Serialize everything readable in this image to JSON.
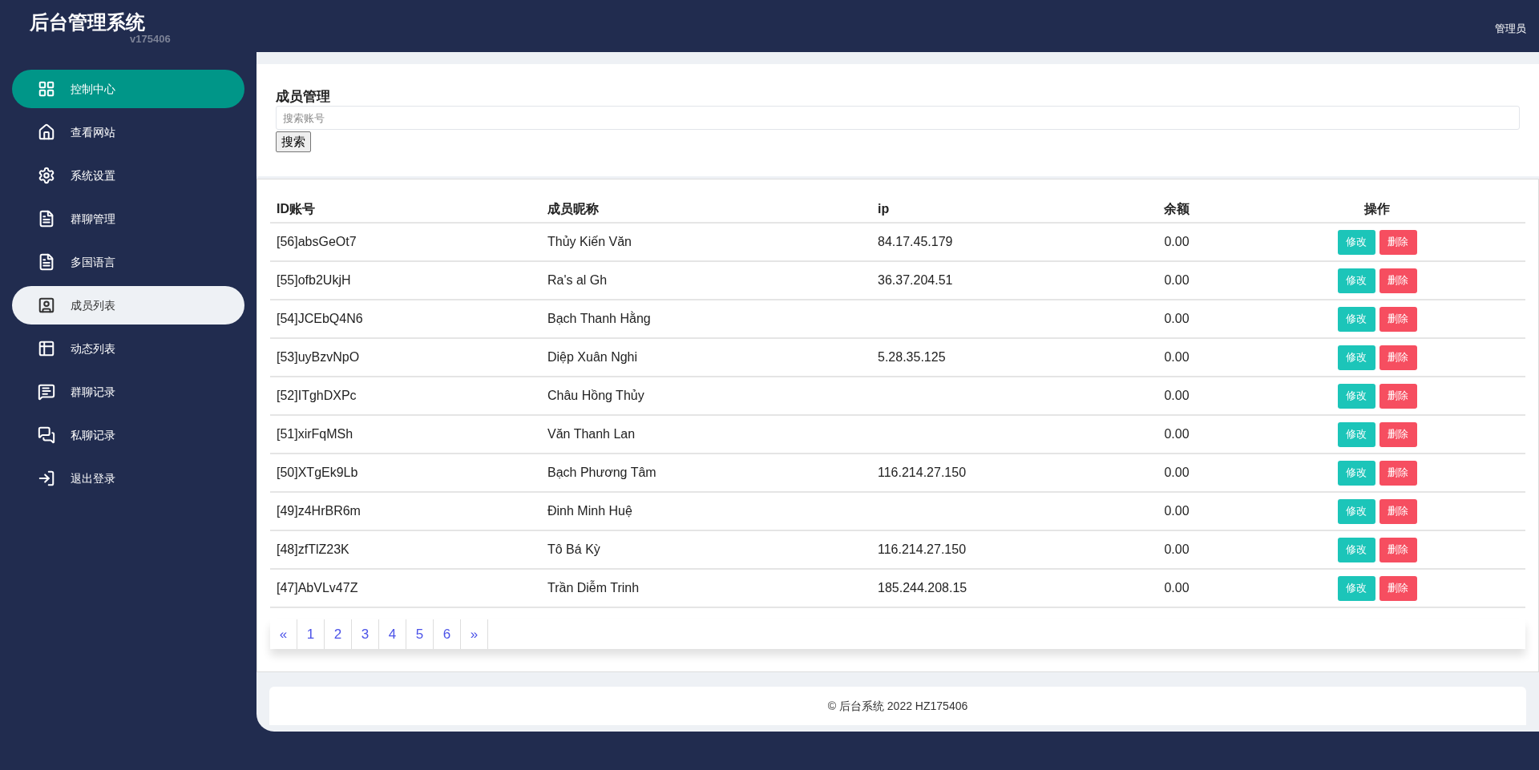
{
  "header": {
    "title": "后台管理系统",
    "version": "v175406",
    "user": "管理员"
  },
  "sidebar": {
    "items": [
      {
        "label": "控制中心",
        "highlighted": true,
        "selected": false
      },
      {
        "label": "查看网站",
        "highlighted": false,
        "selected": false
      },
      {
        "label": "系统设置",
        "highlighted": false,
        "selected": false
      },
      {
        "label": "群聊管理",
        "highlighted": false,
        "selected": false
      },
      {
        "label": "多国语言",
        "highlighted": false,
        "selected": false
      },
      {
        "label": "成员列表",
        "highlighted": false,
        "selected": true
      },
      {
        "label": "动态列表",
        "highlighted": false,
        "selected": false
      },
      {
        "label": "群聊记录",
        "highlighted": false,
        "selected": false
      },
      {
        "label": "私聊记录",
        "highlighted": false,
        "selected": false
      },
      {
        "label": "退出登录",
        "highlighted": false,
        "selected": false
      }
    ]
  },
  "search": {
    "title": "成员管理",
    "placeholder": "搜索账号",
    "button": "搜索"
  },
  "table": {
    "columns": [
      "ID账号",
      "成员昵称",
      "ip",
      "余额",
      "操作"
    ],
    "rows": [
      {
        "id": "[56]absGeOt7",
        "nickname": "Thủy Kiến Văn",
        "ip": "84.17.45.179",
        "balance": "0.00",
        "edit": "修改",
        "delete": "删除"
      },
      {
        "id": "[55]ofb2UkjH",
        "nickname": "Ra's al Gh",
        "ip": "36.37.204.51",
        "balance": "0.00",
        "edit": "修改",
        "delete": "删除"
      },
      {
        "id": "[54]JCEbQ4N6",
        "nickname": "Bạch Thanh Hằng",
        "ip": "",
        "balance": "0.00",
        "edit": "修改",
        "delete": "删除"
      },
      {
        "id": "[53]uyBzvNpO",
        "nickname": "Diệp Xuân Nghi",
        "ip": "5.28.35.125",
        "balance": "0.00",
        "edit": "修改",
        "delete": "删除"
      },
      {
        "id": "[52]ITghDXPc",
        "nickname": "Châu Hồng Thủy",
        "ip": "",
        "balance": "0.00",
        "edit": "修改",
        "delete": "删除"
      },
      {
        "id": "[51]xirFqMSh",
        "nickname": "Văn Thanh Lan",
        "ip": "",
        "balance": "0.00",
        "edit": "修改",
        "delete": "删除"
      },
      {
        "id": "[50]XTgEk9Lb",
        "nickname": "Bạch Phương Tâm",
        "ip": "116.214.27.150",
        "balance": "0.00",
        "edit": "修改",
        "delete": "删除"
      },
      {
        "id": "[49]z4HrBR6m",
        "nickname": "Đinh Minh Huệ",
        "ip": "",
        "balance": "0.00",
        "edit": "修改",
        "delete": "删除"
      },
      {
        "id": "[48]zfTlZ23K",
        "nickname": "Tô Bá Kỳ",
        "ip": "116.214.27.150",
        "balance": "0.00",
        "edit": "修改",
        "delete": "删除"
      },
      {
        "id": "[47]AbVLv47Z",
        "nickname": "Trần Diễm Trinh",
        "ip": "185.244.208.15",
        "balance": "0.00",
        "edit": "修改",
        "delete": "删除"
      }
    ]
  },
  "pagination": [
    "«",
    "1",
    "2",
    "3",
    "4",
    "5",
    "6",
    "»"
  ],
  "footer": "© 后台系统 2022 HZ175406"
}
